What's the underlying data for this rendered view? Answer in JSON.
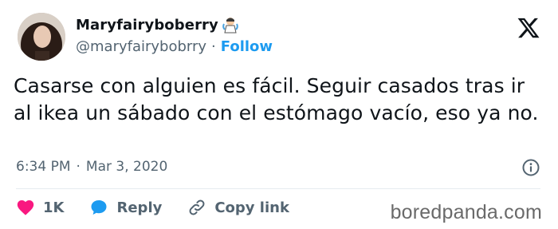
{
  "tweet": {
    "display_name": "Maryfairyboberry",
    "handle": "@maryfairybobrry",
    "separator": "·",
    "follow_label": "Follow",
    "text": "Casarse con alguien es fácil. Seguir casados tras ir al ikea un sábado con el estómago vacío, eso ya no.",
    "time": "6:34 PM",
    "date": "Mar 3, 2020",
    "meta_separator": "·"
  },
  "actions": {
    "like_count": "1K",
    "reply_label": "Reply",
    "copy_link_label": "Copy link"
  },
  "icons": {
    "brand": "x-logo-icon",
    "info": "info-icon",
    "like": "heart-icon",
    "reply": "speech-bubble-icon",
    "copy": "link-icon",
    "badge": "fairy-emoji-icon"
  },
  "colors": {
    "accent": "#1d9bf0",
    "like": "#f91880",
    "muted_text": "#536471",
    "text": "#0f1419"
  },
  "watermark": "boredpanda.com"
}
